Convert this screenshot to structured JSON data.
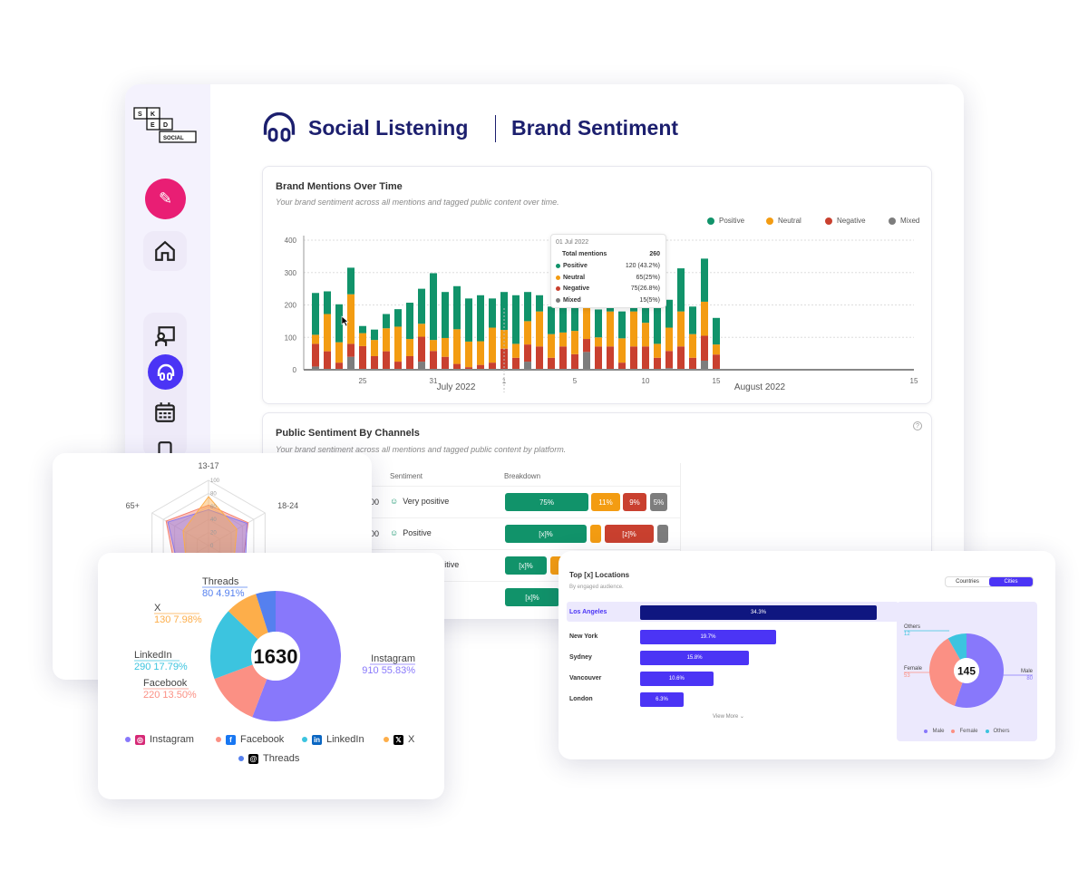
{
  "brand": {
    "logo_text": "SKED SOCIAL",
    "accent": "#4b34f5",
    "navy": "#1c1f6e",
    "pink": "#e91e74"
  },
  "header": {
    "title": "Social Listening",
    "subtitle": "Brand Sentiment"
  },
  "sidebar": {
    "items": [
      {
        "icon": "magic-pencil-icon"
      },
      {
        "icon": "home-icon"
      },
      {
        "icon": "presentation-icon"
      },
      {
        "icon": "headphones-icon",
        "active": true
      },
      {
        "icon": "calendar-icon"
      },
      {
        "icon": "phone-icon"
      }
    ]
  },
  "mentions": {
    "title": "Brand Mentions Over Time",
    "subtitle": "Your brand sentiment across all mentions and tagged public content over time.",
    "tooltip": {
      "date": "01 Jul 2022",
      "total_label": "Total mentions",
      "total": "260",
      "rows": [
        {
          "label": "Positive",
          "value": "120 (43.2%)",
          "color": "#11936a"
        },
        {
          "label": "Neutral",
          "value": "65(25%)",
          "color": "#f39c12"
        },
        {
          "label": "Negative",
          "value": "75(26.8%)",
          "color": "#c9402f"
        },
        {
          "label": "Mixed",
          "value": "15(5%)",
          "color": "#7d7d7d"
        }
      ]
    }
  },
  "chart_data": {
    "type": "bar",
    "stacked": true,
    "legend": [
      "Positive",
      "Neutral",
      "Negative",
      "Mixed"
    ],
    "legend_placement": "top-right",
    "colors": {
      "Positive": "#11936a",
      "Neutral": "#f39c12",
      "Negative": "#c9402f",
      "Mixed": "#7d7d7d"
    },
    "ylim": [
      0,
      400
    ],
    "yticks": [
      0,
      100,
      200,
      300,
      400
    ],
    "grid": true,
    "categories": [
      "",
      "",
      "",
      "",
      "25",
      "",
      "",
      "",
      "",
      "",
      "31",
      "",
      "",
      "",
      "",
      "",
      "1",
      "",
      "",
      "",
      "",
      "",
      "5",
      "",
      "",
      "",
      "",
      "",
      "10",
      "",
      "",
      "",
      "",
      "",
      "15"
    ],
    "months": [
      "July 2022",
      "August 2022"
    ],
    "series": [
      {
        "name": "Mixed",
        "values": [
          10,
          0,
          0,
          40,
          0,
          0,
          0,
          0,
          0,
          25,
          0,
          0,
          0,
          0,
          0,
          0,
          0,
          0,
          25,
          0,
          0,
          0,
          0,
          55,
          0,
          0,
          0,
          0,
          0,
          0,
          5,
          0,
          0,
          28,
          0
        ]
      },
      {
        "name": "Negative",
        "values": [
          70,
          57,
          22,
          40,
          73,
          42,
          57,
          25,
          42,
          77,
          58,
          40,
          18,
          8,
          15,
          22,
          65,
          37,
          53,
          72,
          37,
          72,
          48,
          40,
          72,
          72,
          22,
          72,
          72,
          37,
          53,
          72,
          37,
          77,
          47
        ]
      },
      {
        "name": "Neutral",
        "values": [
          28,
          115,
          63,
          153,
          40,
          50,
          71,
          108,
          53,
          40,
          34,
          58,
          107,
          79,
          73,
          108,
          58,
          43,
          72,
          108,
          73,
          43,
          72,
          107,
          28,
          108,
          75,
          108,
          73,
          43,
          72,
          108,
          73,
          105,
          31
        ]
      },
      {
        "name": "Positive",
        "values": [
          129,
          70,
          117,
          82,
          22,
          32,
          44,
          54,
          112,
          108,
          206,
          142,
          133,
          133,
          142,
          90,
          117,
          150,
          90,
          50,
          85,
          133,
          85,
          131,
          86,
          133,
          83,
          133,
          85,
          133,
          86,
          133,
          85,
          133,
          82
        ]
      }
    ]
  },
  "channels": {
    "title": "Public Sentiment By Channels",
    "subtitle": "Your brand sentiment across all mentions and tagged public content by platform.",
    "columns": [
      "Sentiment",
      "Breakdown"
    ],
    "rows": [
      {
        "count": "00",
        "sentiment": "Very positive",
        "segs": [
          "75%",
          "11%",
          "9%",
          "5%"
        ]
      },
      {
        "count": "00",
        "sentiment": "Positive",
        "segs": [
          "[x]%",
          "",
          "[z]%",
          ""
        ]
      },
      {
        "count": "",
        "sentiment": "Slightly positive",
        "segs": [
          "[x]%",
          ""
        ]
      },
      {
        "count": "",
        "sentiment": "",
        "segs": [
          "[x]%"
        ]
      }
    ]
  },
  "platforms": {
    "total": "1630",
    "items": [
      {
        "name": "Instagram",
        "value": 910,
        "pct": "55.83%",
        "color": "#8878fb"
      },
      {
        "name": "Facebook",
        "value": 220,
        "pct": "13.50%",
        "color": "#fb9084"
      },
      {
        "name": "LinkedIn",
        "value": 290,
        "pct": "17.79%",
        "color": "#3cc4df"
      },
      {
        "name": "X",
        "value": 130,
        "pct": "7.98%",
        "color": "#fdae4a"
      },
      {
        "name": "Threads",
        "value": 80,
        "pct": "4.91%",
        "color": "#5580ef"
      }
    ]
  },
  "age_radar": {
    "axes": [
      "13-17",
      "18-24",
      "",
      "",
      "",
      "65+"
    ],
    "ticks": [
      "0",
      "20",
      "40",
      "60",
      "80",
      "100"
    ],
    "series": [
      {
        "color": "#f38072",
        "values": [
          62,
          70,
          60,
          55,
          60,
          75
        ]
      },
      {
        "color": "#8a78f0",
        "values": [
          55,
          68,
          65,
          60,
          55,
          72
        ]
      },
      {
        "color": "#fdae4a",
        "values": [
          75,
          50,
          45,
          40,
          40,
          45
        ]
      }
    ]
  },
  "locations": {
    "title": "Top [x] Locations",
    "subtitle": "By engaged audience.",
    "toggle": [
      "Countries",
      "Cities"
    ],
    "active": "Cities",
    "cities": [
      {
        "name": "Los Angeles",
        "pct": 34.3,
        "label": "34.3%"
      },
      {
        "name": "New York",
        "pct": 19.7,
        "label": "19.7%"
      },
      {
        "name": "Sydney",
        "pct": 15.8,
        "label": "15.8%"
      },
      {
        "name": "Vancouver",
        "pct": 10.6,
        "label": "10.6%"
      },
      {
        "name": "London",
        "pct": 6.3,
        "label": "6.3%"
      }
    ],
    "view_more": "View More",
    "gender": {
      "total": "145",
      "items": [
        {
          "name": "Male",
          "value": 80,
          "color": "#8878fb"
        },
        {
          "name": "Female",
          "value": 53,
          "color": "#fb9084"
        },
        {
          "name": "Others",
          "value": 12,
          "color": "#3cc4df"
        }
      ]
    }
  }
}
